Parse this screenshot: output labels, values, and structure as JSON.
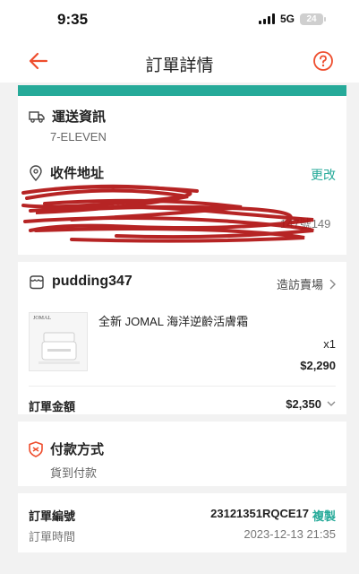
{
  "status": {
    "time": "9:35",
    "network": "5G",
    "battery": "24"
  },
  "nav": {
    "title": "訂單詳情"
  },
  "shipping": {
    "title": "運送資訊",
    "carrier": "7-ELEVEN"
  },
  "address": {
    "title": "收件地址",
    "edit_label": "更改",
    "partial_text": "147號149"
  },
  "shop": {
    "name": "pudding347",
    "visit_label": "造訪賣場"
  },
  "product": {
    "name": "全新 JOMAL 海洋逆齡活膚霜",
    "quantity": "x1",
    "price": "$2,290",
    "thumb_brand": "JOMAL"
  },
  "total": {
    "label": "訂單金額",
    "value": "$2,350"
  },
  "payment": {
    "title": "付款方式",
    "method": "貨到付款"
  },
  "order": {
    "number_label": "訂單編號",
    "number": "23121351RQCE17",
    "copy_label": "複製",
    "time_label": "訂單時間",
    "time": "2023-12-13 21:35"
  },
  "colors": {
    "accent": "#ee4d2d",
    "teal": "#26aa99",
    "scribble": "#b01212"
  }
}
